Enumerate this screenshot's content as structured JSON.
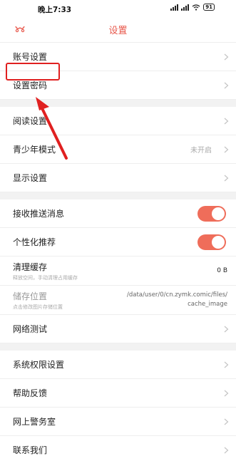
{
  "status": {
    "time": "晚上7:33",
    "battery": "91"
  },
  "header": {
    "title": "设置",
    "back_icon": "back-icon"
  },
  "group1": [
    {
      "label": "账号设置"
    },
    {
      "label": "设置密码"
    }
  ],
  "group2": [
    {
      "label": "阅读设置"
    },
    {
      "label": "青少年模式",
      "value": "未开启"
    },
    {
      "label": "显示设置"
    }
  ],
  "group3": {
    "push": {
      "label": "接收推送消息",
      "enabled": true
    },
    "personal": {
      "label": "个性化推荐",
      "enabled": true
    },
    "cache": {
      "label": "清理缓存",
      "sub": "释放空间，手动清理占用缓存",
      "value": "0 B"
    },
    "storage": {
      "label": "储存位置",
      "sub": "点击修改图片存储位置",
      "path_line1": "/data/user/0/cn.zymk.comic/files/",
      "path_line2": "cache_image"
    },
    "network": {
      "label": "网络测试"
    }
  },
  "group4": [
    {
      "label": "系统权限设置"
    },
    {
      "label": "帮助反馈"
    },
    {
      "label": "网上警务室"
    },
    {
      "label": "联系我们"
    }
  ],
  "colors": {
    "accent": "#e8584c",
    "toggle_on": "#ef6d5a",
    "annotation": "#e02020"
  }
}
